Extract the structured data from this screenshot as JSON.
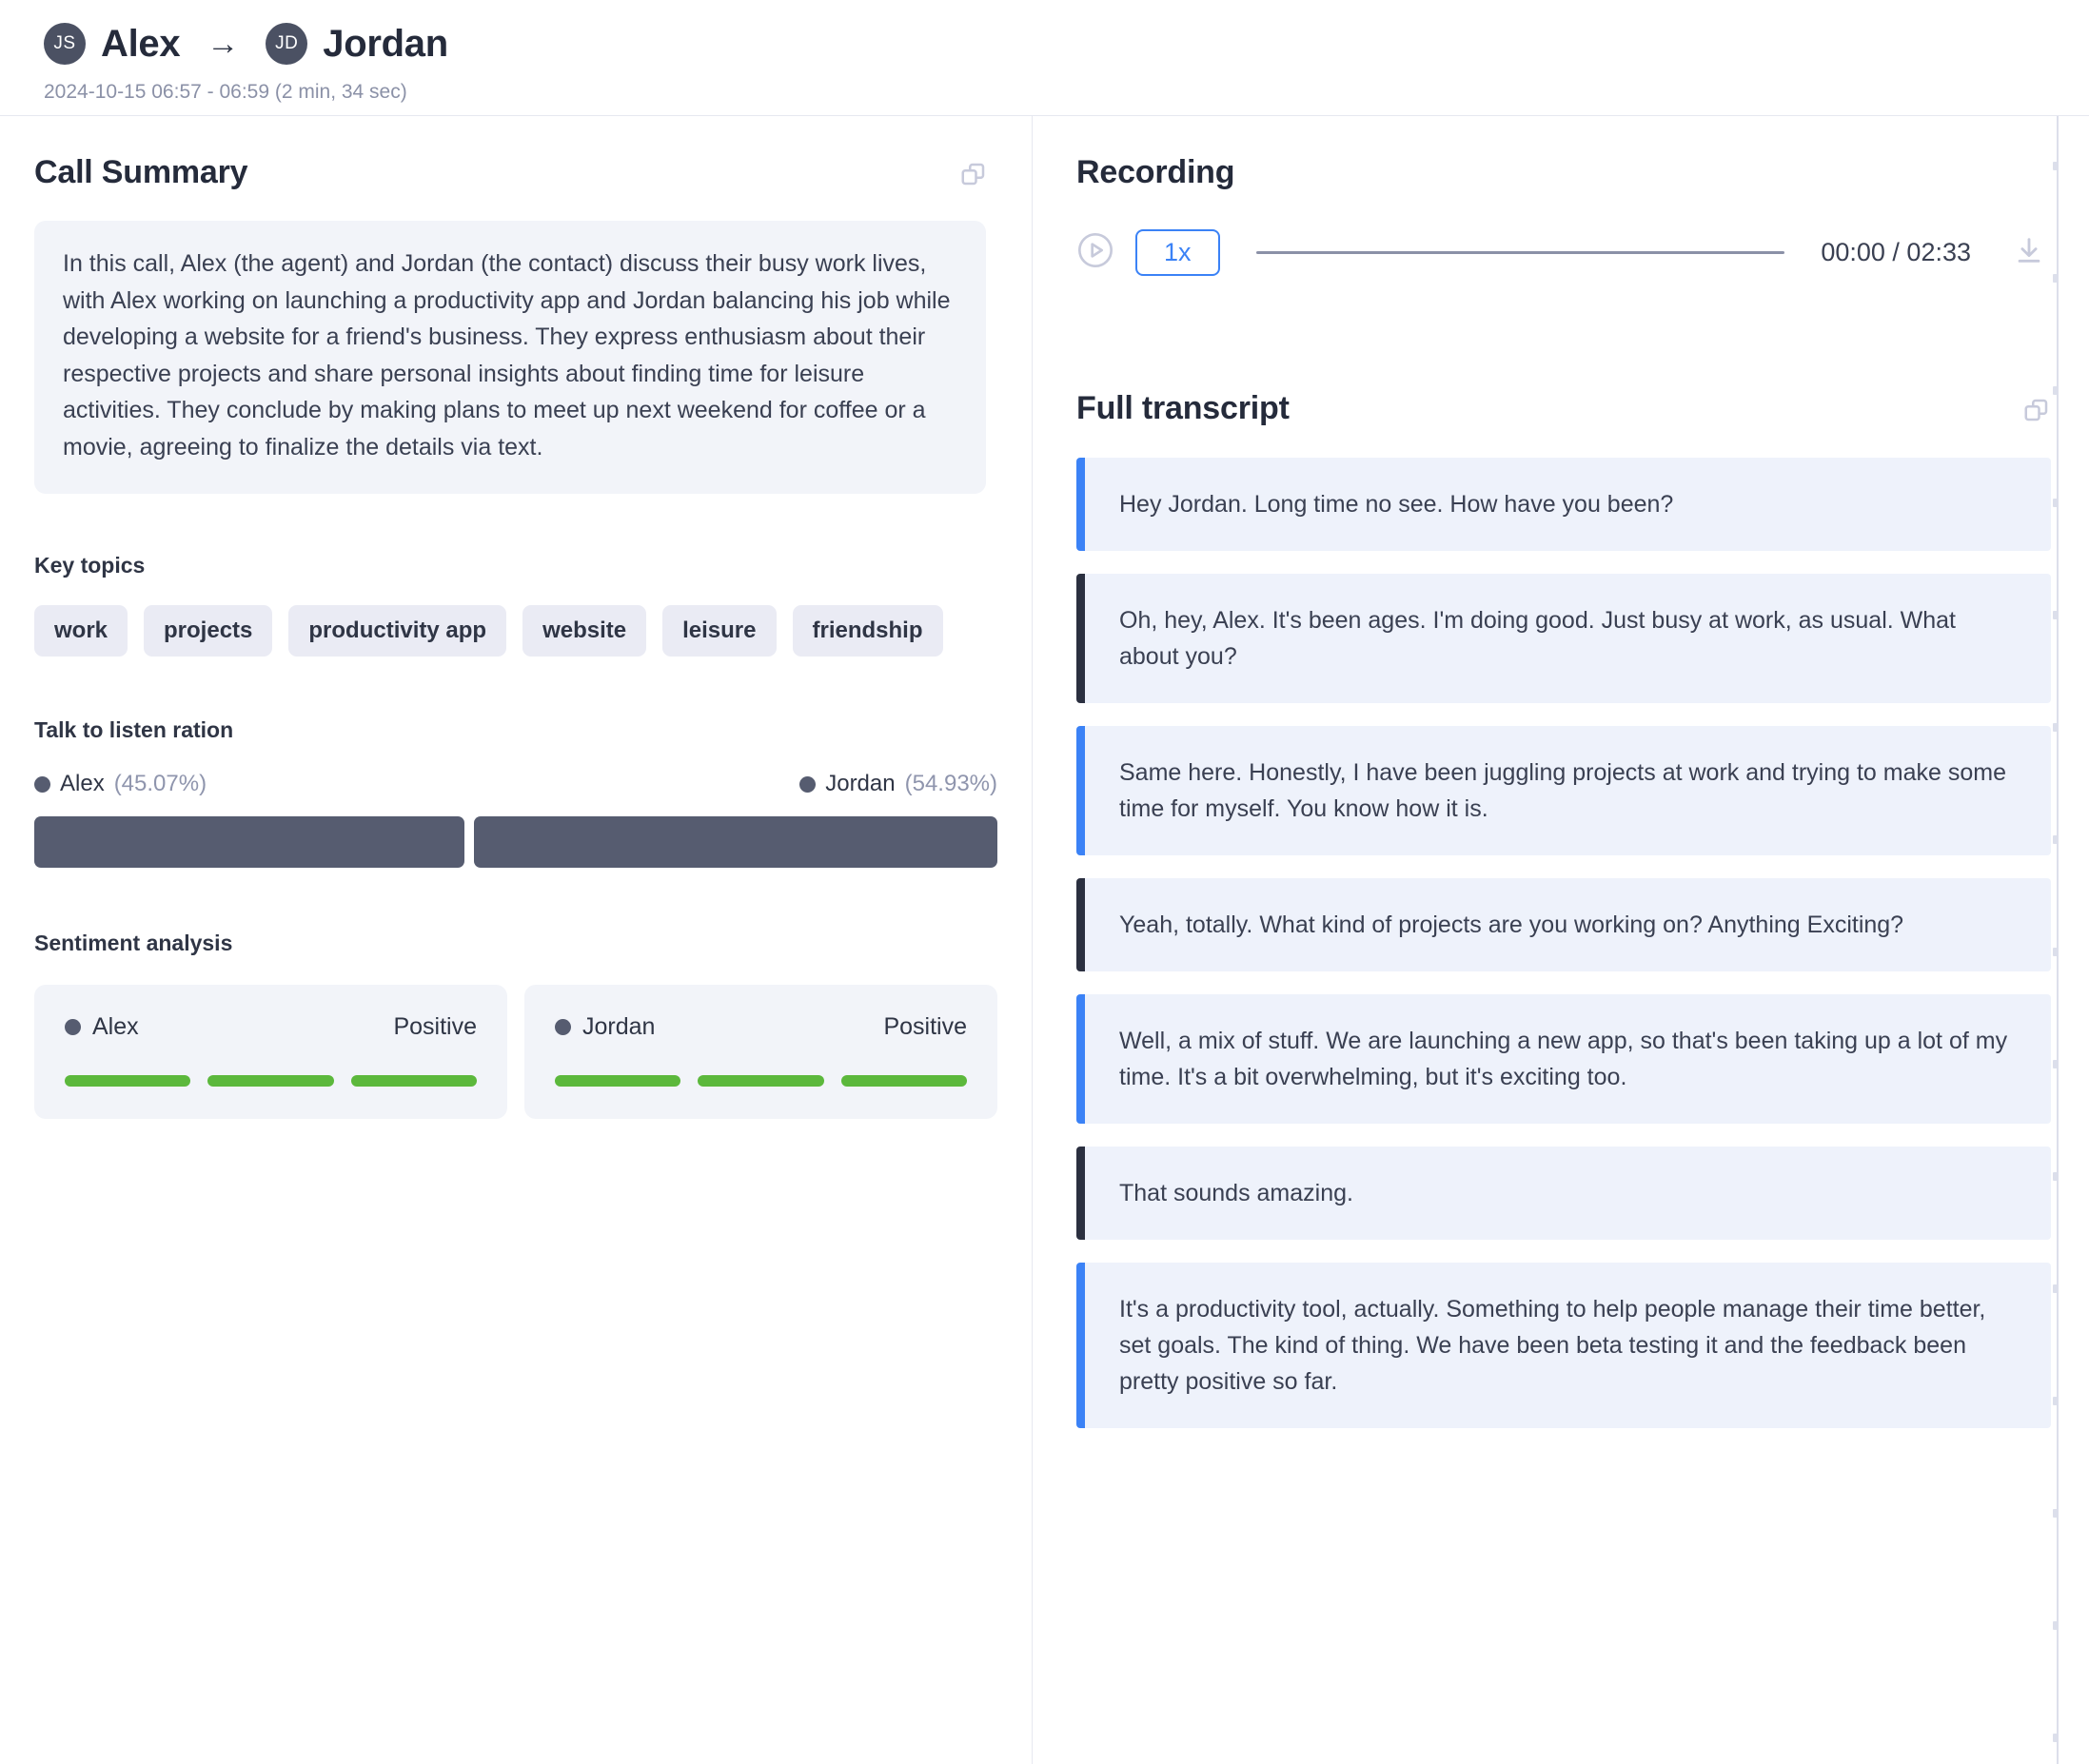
{
  "header": {
    "from_initials": "JS",
    "from_name": "Alex",
    "arrow": "→",
    "to_initials": "JD",
    "to_name": "Jordan",
    "datetime": "2024-10-15 06:57 - 06:59 (2 min, 34 sec)"
  },
  "summary_panel": {
    "title": "Call Summary",
    "expand_icon": "expand-icon",
    "text": "In this call, Alex (the agent) and Jordan (the contact) discuss their busy work lives, with Alex working on launching a productivity app and Jordan balancing his job while developing a website for a friend's business. They express enthusiasm about their respective projects and share personal insights about finding time for leisure activities. They conclude by making plans to meet up next weekend for coffee or a movie, agreeing to finalize the details via text."
  },
  "key_topics": {
    "title": "Key topics",
    "items": [
      "work",
      "projects",
      "productivity app",
      "website",
      "leisure",
      "friendship"
    ]
  },
  "talk_ratio": {
    "title": "Talk to listen ration",
    "speakers": [
      {
        "name": "Alex",
        "percent": "(45.07%)",
        "value": 45.07
      },
      {
        "name": "Jordan",
        "percent": "(54.93%)",
        "value": 54.93
      }
    ]
  },
  "sentiment": {
    "title": "Sentiment analysis",
    "cards": [
      {
        "name": "Alex",
        "label": "Positive",
        "color": "#5cb83c",
        "bars": 3
      },
      {
        "name": "Jordan",
        "label": "Positive",
        "color": "#5cb83c",
        "bars": 3
      }
    ]
  },
  "recording": {
    "title": "Recording",
    "play_icon": "play-circle-icon",
    "speed": "1x",
    "time": "00:00 / 02:33",
    "download_icon": "download-icon",
    "progress_percent": 0
  },
  "transcript": {
    "title": "Full transcript",
    "expand_icon": "expand-icon",
    "messages": [
      {
        "speaker": "Alex",
        "side": "alex",
        "text": "Hey Jordan. Long time no see. How have you been?"
      },
      {
        "speaker": "Jordan",
        "side": "jordan",
        "text": "Oh, hey, Alex. It's been ages. I'm doing good. Just busy at work, as usual. What about you?"
      },
      {
        "speaker": "Alex",
        "side": "alex",
        "text": "Same here. Honestly, I have been juggling projects at work and trying to make some time for myself. You know how it is."
      },
      {
        "speaker": "Jordan",
        "side": "jordan",
        "text": "Yeah, totally. What kind of projects are you working on? Anything Exciting?"
      },
      {
        "speaker": "Alex",
        "side": "alex",
        "text": "Well, a mix of stuff. We are launching a new app, so that's been taking up a lot of my time. It's a bit overwhelming, but it's exciting too."
      },
      {
        "speaker": "Jordan",
        "side": "jordan",
        "text": "That sounds amazing."
      },
      {
        "speaker": "Alex",
        "side": "alex",
        "text": "It's a productivity tool, actually. Something to help people manage their time better, set goals. The kind of thing. We have been beta testing it and the feedback been pretty positive so far."
      }
    ]
  },
  "colors": {
    "accent_blue": "#3b82f6",
    "speaker_dark": "#2b3040",
    "avatar": "#4b5163",
    "sentiment_green": "#5cb83c",
    "bubble_bg": "#eef2fb",
    "panel_bg": "#f2f4f9"
  }
}
